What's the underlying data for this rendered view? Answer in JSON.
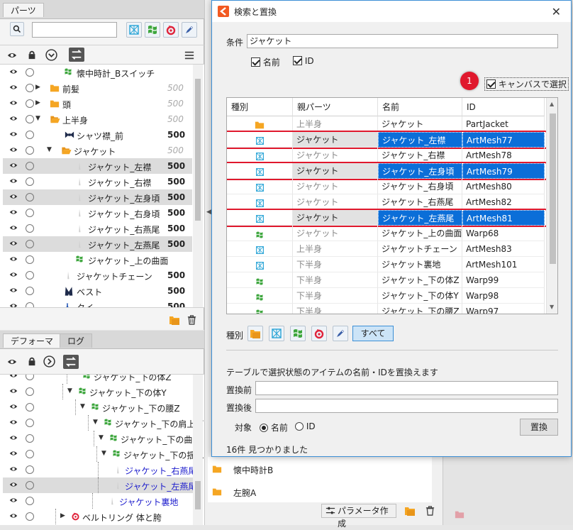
{
  "colors": {
    "accent": "#0b6ed8",
    "highlight_border": "#e0182d",
    "folder": "#f5a623",
    "warp": "#3da63d",
    "artmesh": "#27a3d6",
    "glue": "#e0243b"
  },
  "parts_panel": {
    "tab": "パーツ",
    "search_placeholder": "",
    "rows": [
      {
        "label": "懐中時計_Bスイッチ",
        "value": "",
        "dim": false,
        "icon": "warp-icon"
      },
      {
        "label": "前髪",
        "value": "500",
        "dim": true,
        "icon": "folder-icon"
      },
      {
        "label": "頭",
        "value": "500",
        "dim": true,
        "icon": "folder-icon"
      },
      {
        "label": "上半身",
        "value": "500",
        "dim": true,
        "icon": "folder-open-icon"
      },
      {
        "label": "シャツ襟_前",
        "value": "500",
        "dim": false,
        "icon": "bow-icon"
      },
      {
        "label": "ジャケット",
        "value": "500",
        "dim": true,
        "icon": "folder-open-icon"
      },
      {
        "label": "ジャケット_左襟",
        "value": "500",
        "dim": false,
        "icon": "mesh-thumb-icon"
      },
      {
        "label": "ジャケット_右襟",
        "value": "500",
        "dim": false,
        "icon": "mesh-thumb-icon"
      },
      {
        "label": "ジャケット_左身頃",
        "value": "500",
        "dim": false,
        "icon": "mesh-thumb-icon"
      },
      {
        "label": "ジャケット_右身頃",
        "value": "500",
        "dim": false,
        "icon": "mesh-thumb-icon"
      },
      {
        "label": "ジャケット_右燕尾",
        "value": "500",
        "dim": false,
        "icon": "mesh-thumb-icon"
      },
      {
        "label": "ジャケット_左燕尾",
        "value": "500",
        "dim": false,
        "icon": "mesh-thumb-icon"
      },
      {
        "label": "ジャケット_上の曲面",
        "value": "",
        "dim": false,
        "icon": "warp-icon"
      },
      {
        "label": "ジャケットチェーン",
        "value": "500",
        "dim": false,
        "icon": "mesh-thumb-icon"
      },
      {
        "label": "ベスト",
        "value": "500",
        "dim": false,
        "icon": "vest-icon"
      },
      {
        "label": "タイ",
        "value": "500",
        "dim": false,
        "icon": "tie-icon"
      }
    ]
  },
  "deformer_panel": {
    "tabs": [
      "デフォーマ",
      "ログ"
    ],
    "rows": [
      {
        "label": "ジャケット_下の体Z",
        "blue": false
      },
      {
        "label": "ジャケット_下の体Y",
        "blue": false
      },
      {
        "label": "ジャケット_下の腰Z",
        "blue": false
      },
      {
        "label": "ジャケット_下の肩上下",
        "blue": false
      },
      {
        "label": "ジャケット_下の曲面",
        "blue": false
      },
      {
        "label": "ジャケット_下の揺れ",
        "blue": false
      },
      {
        "label": "ジャケット_右燕尾",
        "blue": true
      },
      {
        "label": "ジャケット_左燕尾",
        "blue": true
      },
      {
        "label": "ジャケット裏地",
        "blue": true
      },
      {
        "label": "ベルトリング 体と胯",
        "blue": false
      }
    ]
  },
  "behind_list": {
    "items": [
      "懐中時計B",
      "左腕A"
    ],
    "param_button": "パラメータ作成"
  },
  "dialog": {
    "title": "検索と置換",
    "condition_label": "条件",
    "condition_value": "ジャケット",
    "check_name": "名前",
    "check_id": "ID",
    "badge": "1",
    "canvas_select": "キャンバスで選択",
    "columns": [
      "種別",
      "親パーツ",
      "名前",
      "ID"
    ],
    "rows": [
      {
        "type": "folder",
        "parent": "上半身",
        "name": "ジャケット",
        "id": "PartJacket",
        "hl": false,
        "box": false
      },
      {
        "type": "artmesh",
        "parent": "ジャケット",
        "name": "ジャケット_左襟",
        "id": "ArtMesh77",
        "hl": true,
        "box": true
      },
      {
        "type": "artmesh",
        "parent": "ジャケット",
        "name": "ジャケット_右襟",
        "id": "ArtMesh78",
        "hl": false,
        "box": false
      },
      {
        "type": "artmesh",
        "parent": "ジャケット",
        "name": "ジャケット_左身頃",
        "id": "ArtMesh79",
        "hl": true,
        "box": true
      },
      {
        "type": "artmesh",
        "parent": "ジャケット",
        "name": "ジャケット_右身頃",
        "id": "ArtMesh80",
        "hl": false,
        "box": false
      },
      {
        "type": "artmesh",
        "parent": "ジャケット",
        "name": "ジャケット_右燕尾",
        "id": "ArtMesh82",
        "hl": false,
        "box": false
      },
      {
        "type": "artmesh",
        "parent": "ジャケット",
        "name": "ジャケット_左燕尾",
        "id": "ArtMesh81",
        "hl": true,
        "box": true
      },
      {
        "type": "warp",
        "parent": "ジャケット",
        "name": "ジャケット_上の曲面",
        "id": "Warp68",
        "hl": false,
        "box": false
      },
      {
        "type": "artmesh",
        "parent": "上半身",
        "name": "ジャケットチェーン",
        "id": "ArtMesh83",
        "hl": false,
        "box": false
      },
      {
        "type": "artmesh",
        "parent": "下半身",
        "name": "ジャケット裏地",
        "id": "ArtMesh101",
        "hl": false,
        "box": false
      },
      {
        "type": "warp",
        "parent": "下半身",
        "name": "ジャケット_下の体Z",
        "id": "Warp99",
        "hl": false,
        "box": false
      },
      {
        "type": "warp",
        "parent": "下半身",
        "name": "ジャケット_下の体Y",
        "id": "Warp98",
        "hl": false,
        "box": false
      },
      {
        "type": "warp",
        "parent": "下半身",
        "name": "ジャケット_下の腰Z",
        "id": "Warp97",
        "hl": false,
        "box": false
      }
    ],
    "type_filter_label": "種別",
    "all_button": "すべて",
    "replace_desc": "テーブルで選択状態のアイテムの名前・IDを置換えます",
    "before_label": "置換前",
    "after_label": "置換後",
    "before_value": "",
    "after_value": "",
    "target_label": "対象",
    "target_name": "名前",
    "target_id": "ID",
    "replace_button": "置換",
    "result": "16件 見つかりました"
  }
}
